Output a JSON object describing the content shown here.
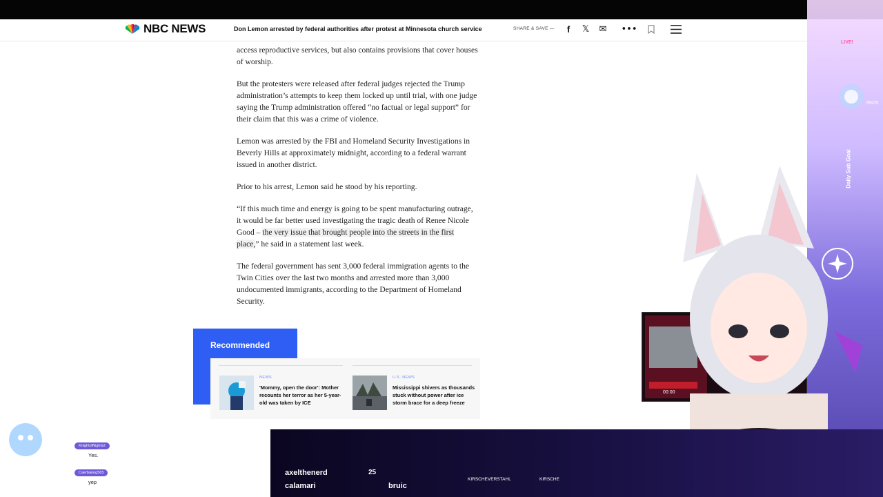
{
  "header": {
    "logo_text": "NBC NEWS",
    "headline": "Don Lemon arrested by federal authorities after protest at Minnesota church service",
    "share_label": "SHARE & SAVE —",
    "icons": [
      "facebook-icon",
      "x-icon",
      "mail-icon",
      "more-icon",
      "bookmark-icon",
      "menu-icon"
    ]
  },
  "article": {
    "p1": "access reproductive services, but also contains provisions that cover houses of worship.",
    "p2": "But the protesters were released after federal judges rejected the Trump administration’s attempts to keep them locked up until trial, with one judge saying the Trump administration offered “no factual or legal support” for their claim that this was a crime of violence.",
    "p3": "Lemon was arrested by the FBI and Homeland Security Investigations in Beverly Hills at approximately midnight, according to a federal warrant issued in another district.",
    "p4": "Prior to his arrest, Lemon said he stood by his reporting.",
    "p5a": "“If this much time and energy is going to be spent manufacturing outrage, it would be far better used investigating the tragic death of Renee Nicole Good – ",
    "p5b": "the very issue that brought people into the streets in the first place,",
    "p5c": "” he said in a statement last week.",
    "p6": "The federal government has sent 3,000 federal immigration agents to the Twin Cities over the last two months and arrested more than 3,000 undocumented immigrants, according to the Department of Homeland Security."
  },
  "recommended": {
    "title": "Recommended",
    "items": [
      {
        "category": "NEWS",
        "headline": "'Mommy, open the door': Mother recounts her terror as her 5-year-old was taken by ICE"
      },
      {
        "category": "U.S. NEWS",
        "headline": "Mississippi shivers as thousands stuck without power after ice storm brace for a deep freeze"
      }
    ]
  },
  "overlay": {
    "live_label": "LIVE!",
    "sub_goal_label": "Daily Sub Goal",
    "sub_goal_count": "69/25",
    "chat": [
      {
        "user": "KnightofNights2",
        "message": "Yes."
      },
      {
        "user": "Caerbanog565",
        "message": "yep"
      }
    ],
    "gifts": [
      {
        "user": "axelthenerd",
        "amount": "25"
      },
      {
        "user": "calamari",
        "amount": ""
      },
      {
        "user": "bruiс",
        "amount": ""
      }
    ],
    "socials": [
      "KIRSCHEVERSTAHL",
      "KIRSCHE"
    ],
    "video_time": "00:00"
  }
}
